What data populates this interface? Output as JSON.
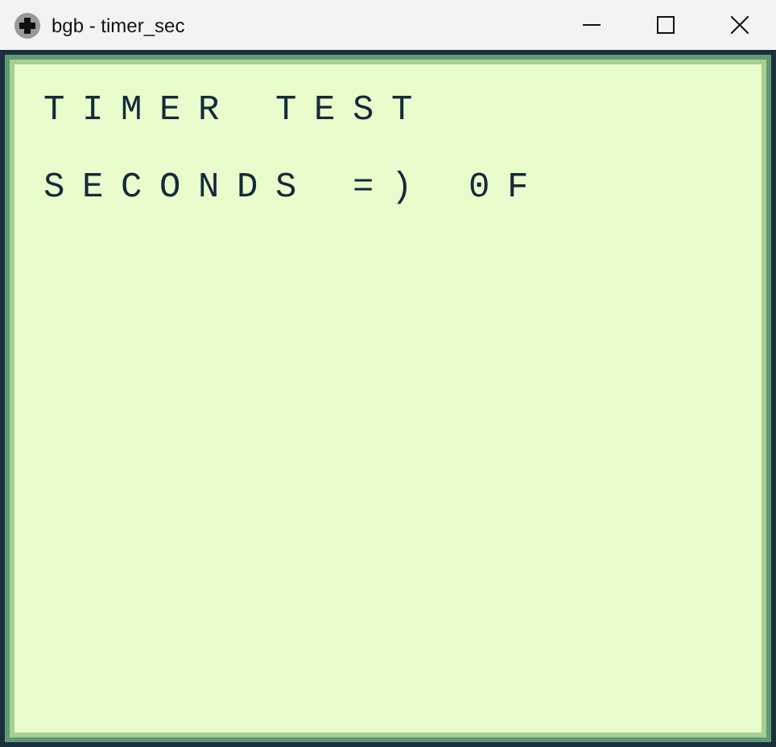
{
  "window": {
    "title": "bgb - timer_sec"
  },
  "screen": {
    "lines": [
      "TIMER TEST",
      "SECONDS =) 0F"
    ]
  }
}
